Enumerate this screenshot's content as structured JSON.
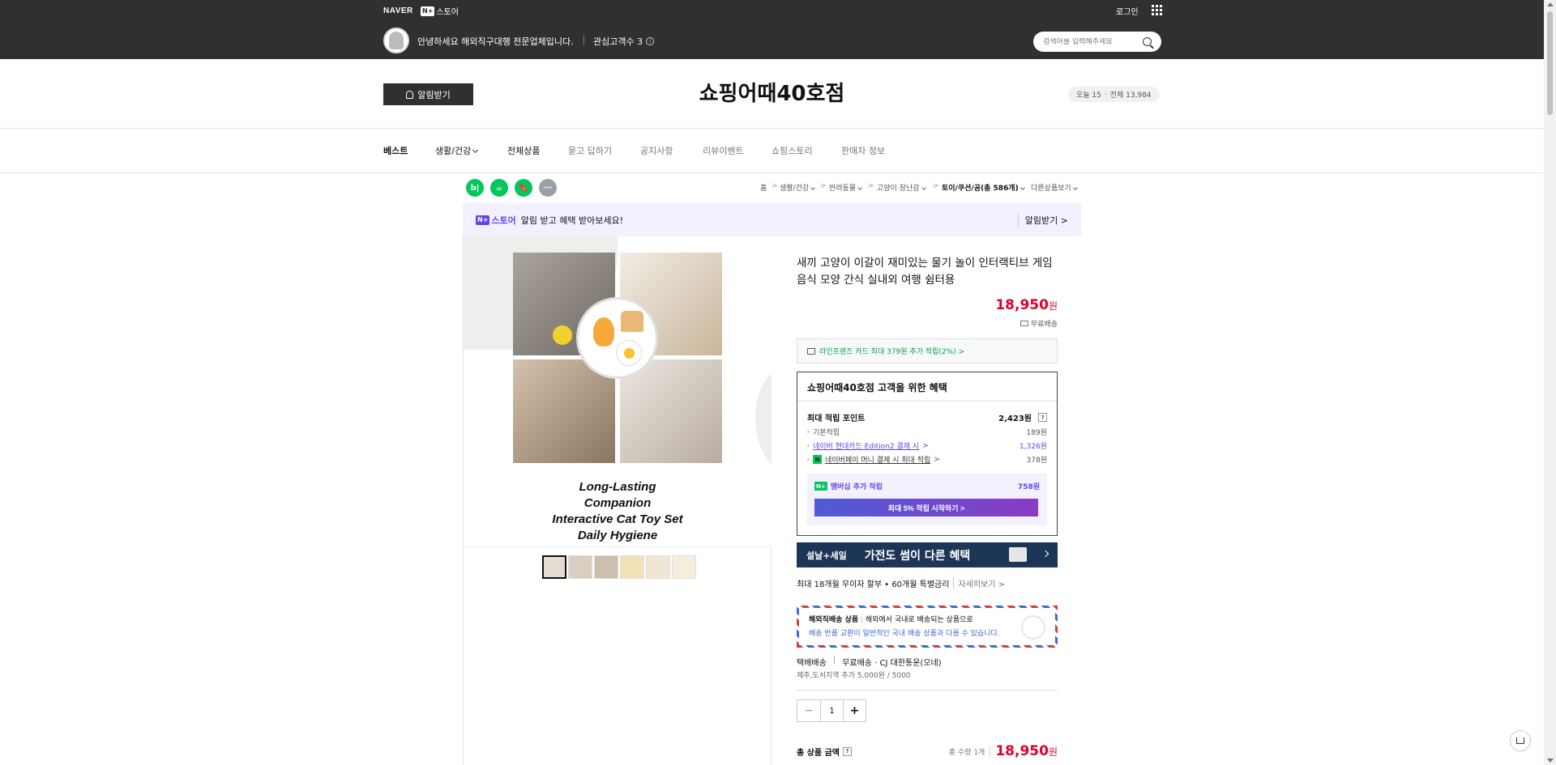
{
  "topbar": {
    "naver": "NAVER",
    "store_badge": "N+",
    "store_label": "스토어",
    "login": "로그인",
    "greeting": "안녕하세요 해외직구대행 전문업체입니다.",
    "followers_label": "관심고객수 3",
    "info_glyph": "i",
    "search_placeholder": "검색어를 입력해주세요"
  },
  "header": {
    "alarm_button": "알림받기",
    "store_title": "쇼핑어때40호점",
    "visitors_today": "오늘 15",
    "visitors_sep": "·",
    "visitors_total": "전체 13,984"
  },
  "nav": {
    "items": [
      {
        "label": "베스트"
      },
      {
        "label": "생활/건강"
      },
      {
        "label": "전체상품"
      },
      {
        "label": "묻고 답하기"
      },
      {
        "label": "공지사항"
      },
      {
        "label": "리뷰이벤트"
      },
      {
        "label": "쇼핑스토리"
      },
      {
        "label": "판매자 정보"
      }
    ]
  },
  "share": {
    "blog_glyph": "b|",
    "cafe_glyph": "☕",
    "bookmark_glyph": "🔖",
    "more_glyph": "⋯"
  },
  "breadcrumb": {
    "home": "홈",
    "arrow": ">",
    "c1": "생활/건강",
    "c2": "반려동물",
    "c3": "고양이 장난감",
    "c4": "토이/쿠션/공(총 586개)",
    "other": "다른상품보기"
  },
  "noti": {
    "badge": "N+",
    "store": "스토어",
    "text": "알림 받고 혜택 받아보세요!",
    "right": "알림받기 >"
  },
  "gallery": {
    "caption_line1": "Long-Lasting Companion",
    "caption_line2": "Interactive Cat Toy Set",
    "caption_line3": "Daily  Hygiene"
  },
  "product": {
    "title": "새끼 고양이 이갈이 재미있는 물기 놀이 인터랙티브 게임 음식 모양 간식 실내외 여행 쉼터용",
    "price": "18,950",
    "won": "원",
    "shipping": "무료배송",
    "card_promo": "라인프렌즈 카드 최대 379원 추가 적립(2%) >"
  },
  "benefit": {
    "head": "쇼핑어때40호점 고객을 위한 혜택",
    "max_label": "최대 적립 포인트",
    "max_value": "2,423원",
    "q": "?",
    "base_label": "기본적립",
    "base_value": "189원",
    "card_label": "네이버 현대카드 Edition2 결제 시",
    "card_chev": ">",
    "card_value": "1,326원",
    "np_badge": "N",
    "pay_label": "네이버페이 머니 결제 시 최대 적립",
    "pay_chev": ">",
    "pay_value": "378원",
    "member_badge": "N+",
    "member_label": "멤버십 추가 적립",
    "member_value": "758원",
    "member_button": "최대 5% 적립 시작하기 >"
  },
  "promo": {
    "left": "설날+세일",
    "right": "가전도 썸이 다른 혜택"
  },
  "installment": {
    "text": "최대 18개월 무이자 할부 • 60개월 특별금리",
    "more": "자세히보기 >"
  },
  "overseas": {
    "title": "해외직배송 상품",
    "sep": "|",
    "desc": "해외에서 국내로 배송되는 상품으로",
    "note": "배송 반품 교환이 일반적인 국내 배송 상품과 다를 수 있습니다."
  },
  "delivery": {
    "method": "택배배송",
    "sep": "|",
    "detail": "무료배송 · CJ 대한통운(오네)",
    "extra": "제주,도서지역 추가 5,000원 / 5000"
  },
  "quantity": {
    "minus": "−",
    "value": "1",
    "plus": "+"
  },
  "total": {
    "label": "총 상품 금액",
    "q": "?",
    "qty": "총 수량 1개",
    "price": "18,950",
    "won": "원"
  }
}
